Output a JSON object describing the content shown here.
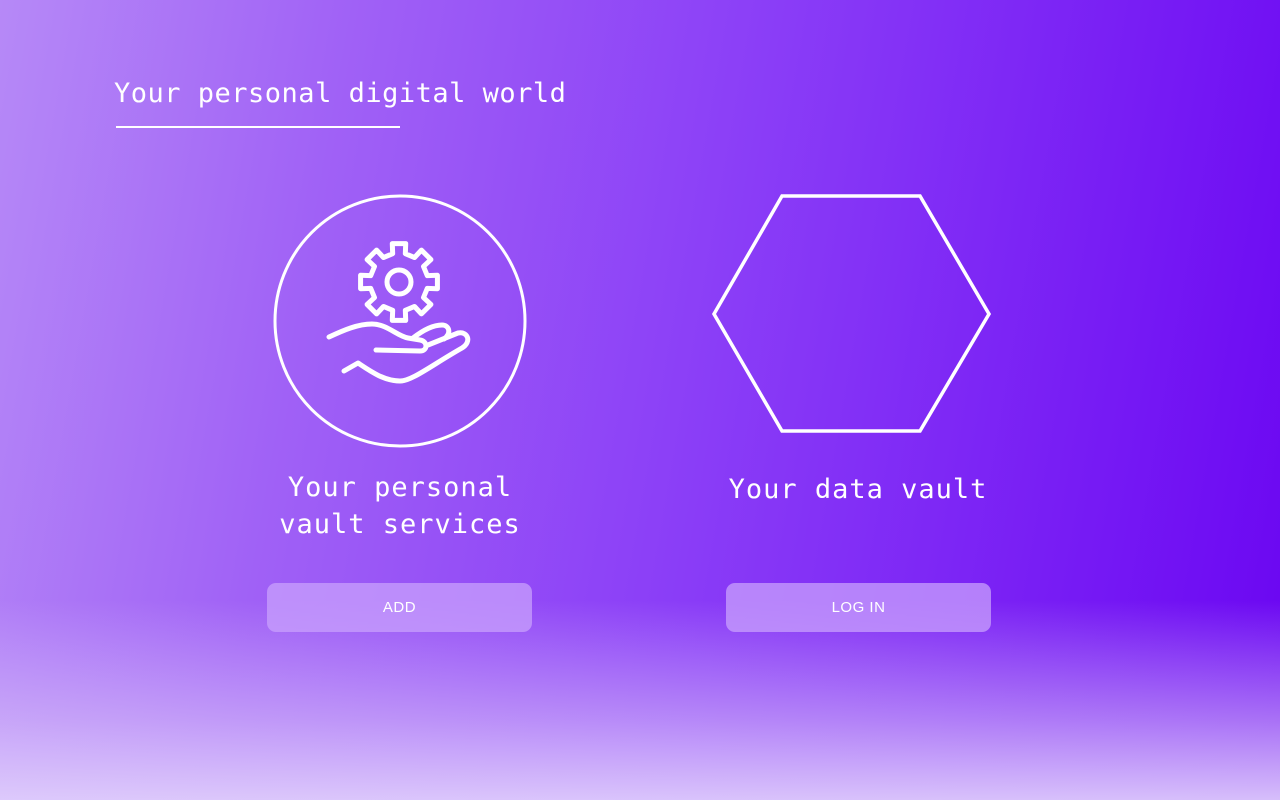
{
  "header": {
    "title": "Your personal digital world"
  },
  "cards": [
    {
      "icon": "hand-gear-icon",
      "label": "Your personal vault services",
      "button_label": "ADD"
    },
    {
      "icon": "hexagon-icon",
      "label": "Your data vault",
      "button_label": "LOG IN"
    }
  ],
  "colors": {
    "gradient_start": "#b689f7",
    "gradient_end": "#6a05f2",
    "button_bg": "#c8a0fc",
    "text": "#ffffff"
  }
}
